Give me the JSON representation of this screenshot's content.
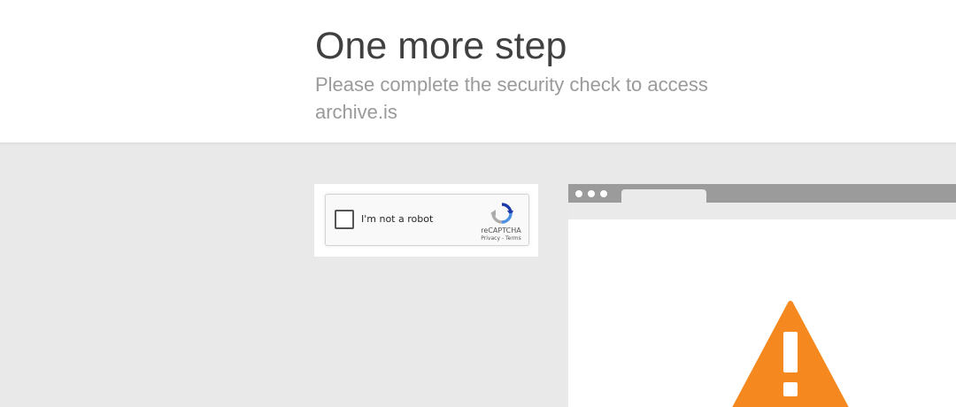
{
  "header": {
    "title": "One more step",
    "subtitle": "Please complete the security check to access archive.is"
  },
  "captcha": {
    "label": "I'm not a robot",
    "brand": "reCAPTCHA",
    "privacy_link": "Privacy",
    "separator": "-",
    "terms_link": "Terms",
    "checked": false,
    "logo_icon": "recaptcha-logo-icon"
  },
  "illustration": {
    "warning_icon": "warning-triangle-icon",
    "warning_color": "#f5891f",
    "browser_bar_color": "#9b9b9b"
  },
  "colors": {
    "page_background": "#e9e9e9",
    "header_background": "#ffffff",
    "title": "#404040",
    "subtitle": "#9a9a9a"
  }
}
